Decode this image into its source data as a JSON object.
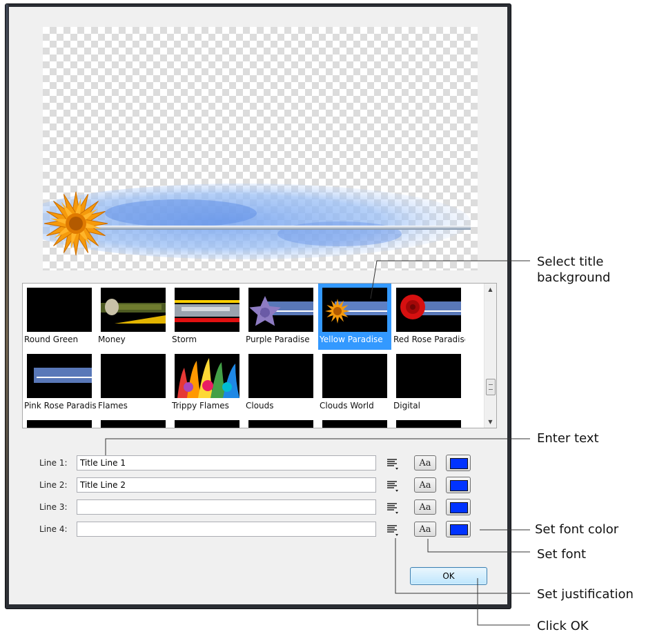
{
  "dialog": {
    "gallery": {
      "items": [
        {
          "label": "Round Green",
          "selected": false
        },
        {
          "label": "Money",
          "selected": false
        },
        {
          "label": "Storm",
          "selected": false
        },
        {
          "label": "Purple Paradise",
          "selected": false
        },
        {
          "label": "Yellow Paradise",
          "selected": true
        },
        {
          "label": "Red Rose Paradise",
          "selected": false
        },
        {
          "label": "Pink Rose Paradise",
          "selected": false
        },
        {
          "label": "Flames",
          "selected": false
        },
        {
          "label": "Trippy Flames",
          "selected": false
        },
        {
          "label": "Clouds",
          "selected": false
        },
        {
          "label": "Clouds World",
          "selected": false
        },
        {
          "label": "Digital",
          "selected": false
        }
      ]
    },
    "lines": [
      {
        "label": "Line 1:",
        "value": "Title Line 1"
      },
      {
        "label": "Line 2:",
        "value": "Title Line 2"
      },
      {
        "label": "Line 3:",
        "value": ""
      },
      {
        "label": "Line 4:",
        "value": ""
      }
    ],
    "font_button_label": "Aa",
    "font_color": "#0033ff",
    "ok_label": "OK"
  },
  "callouts": {
    "select_background": "Select title background",
    "enter_text": "Enter text",
    "set_font_color": "Set font color",
    "set_font": "Set font",
    "set_justification": "Set justification",
    "click_ok": "Click OK"
  },
  "icons": [
    "justify-icon",
    "scroll-up-arrow-icon",
    "scroll-down-arrow-icon"
  ]
}
